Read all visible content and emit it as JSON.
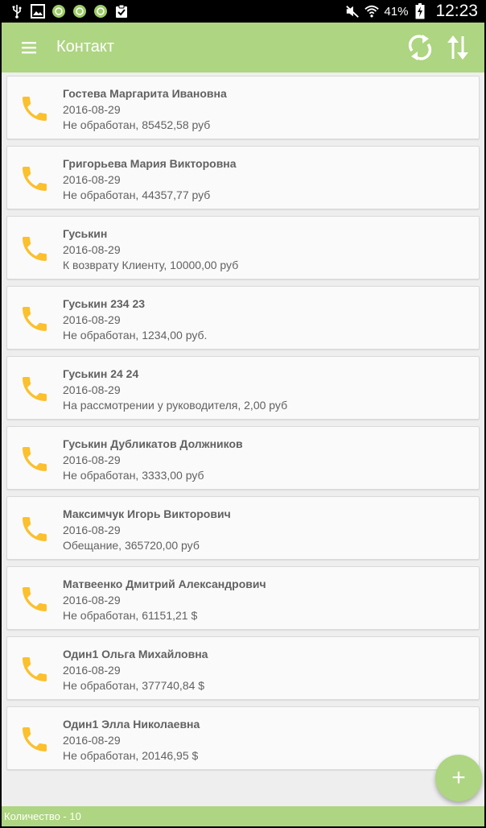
{
  "status_bar": {
    "battery_percent": "41%",
    "time": "12:23"
  },
  "app_bar": {
    "title": "Контакт",
    "menu_icon": "menu-icon",
    "sync_icon": "sync-icon",
    "sort_icon": "sort-icon"
  },
  "contacts": [
    {
      "name": "Гостева Маргарита Ивановна",
      "date": "2016-08-29",
      "status": "Не обработан, 85452,58 руб"
    },
    {
      "name": "Григорьева Мария Викторовна",
      "date": "2016-08-29",
      "status": "Не обработан, 44357,77 руб"
    },
    {
      "name": "Гуськин",
      "date": "2016-08-29",
      "status": "К возврату Клиенту, 10000,00 руб"
    },
    {
      "name": "Гуськин 234 23",
      "date": "2016-08-29",
      "status": "Не обработан, 1234,00 руб."
    },
    {
      "name": "Гуськин 24 24",
      "date": "2016-08-29",
      "status": "На рассмотрении у руководителя, 2,00 руб"
    },
    {
      "name": "Гуськин Дубликатов Должников",
      "date": "2016-08-29",
      "status": "Не обработан, 3333,00 руб"
    },
    {
      "name": "Максимчук Игорь Викторович",
      "date": "2016-08-29",
      "status": "Обещание, 365720,00 руб"
    },
    {
      "name": "Матвеенко Дмитрий Александрович",
      "date": "2016-08-29",
      "status": "Не обработан, 61151,21 $"
    },
    {
      "name": "Один1 Ольга Михайловна",
      "date": "2016-08-29",
      "status": "Не обработан, 377740,84 $"
    },
    {
      "name": "Один1 Элла Николаевна",
      "date": "2016-08-29",
      "status": "Не обработан, 20146,95 $"
    }
  ],
  "fab": {
    "label": "+"
  },
  "footer": {
    "count_text": "Количество - 10"
  },
  "colors": {
    "accent": "#aed581",
    "phone_icon": "#fbc02d",
    "text": "#616161"
  }
}
